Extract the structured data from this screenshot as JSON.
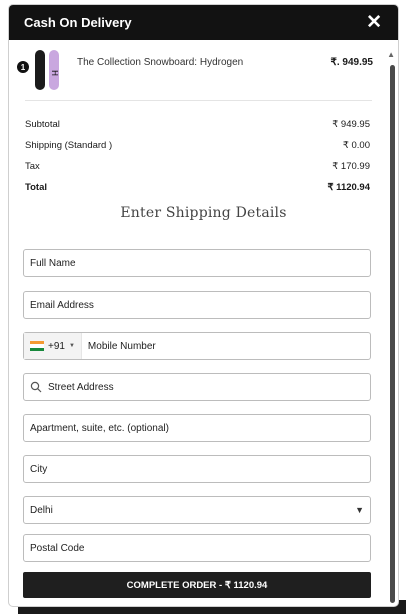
{
  "header": {
    "title": "Cash On Delivery",
    "close_icon": "close-icon"
  },
  "product": {
    "quantity": "1",
    "name": "The Collection Snowboard: Hydrogen",
    "price": "₹. 949.95",
    "colors": {
      "board_dark": "#1b1b1b",
      "board_light": "#c9a7df"
    }
  },
  "summary": {
    "rows": [
      {
        "label": "Subtotal",
        "value": "₹ 949.95"
      },
      {
        "label": "Shipping (Standard )",
        "value": "₹ 0.00"
      },
      {
        "label": "Tax",
        "value": "₹ 170.99"
      }
    ],
    "total": {
      "label": "Total",
      "value": "₹ 1120.94"
    }
  },
  "shipping": {
    "title": "Enter Shipping Details",
    "full_name": "Full Name",
    "email": "Email Address",
    "dial_code": "+91",
    "mobile": "Mobile Number",
    "street": "Street Address",
    "apartment": "Apartment, suite, etc. (optional)",
    "city": "City",
    "state_selected": "Delhi",
    "postal": "Postal Code"
  },
  "submit_label": "COMPLETE ORDER - ₹ 1120.94",
  "colors": {
    "header_bg": "#121212",
    "button_bg": "#1f1f1f"
  }
}
